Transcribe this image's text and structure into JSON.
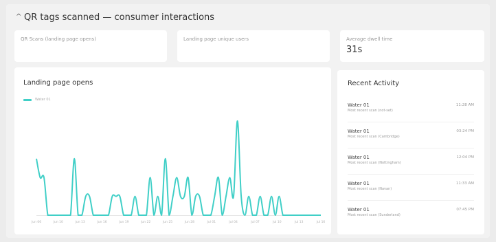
{
  "header": {
    "title": "QR tags scanned — consumer interactions"
  },
  "stats": [
    {
      "label": "QR Scans (landing page opens)",
      "value": ""
    },
    {
      "label": "Landing page unique users",
      "value": ""
    },
    {
      "label": "Average dwell time",
      "value": "31s"
    }
  ],
  "chart_card": {
    "title": "Landing page opens"
  },
  "chart_data": {
    "type": "line",
    "title": "Landing page opens",
    "xlabel": "",
    "ylabel": "",
    "legend_position": "top-left",
    "grid": false,
    "series": [
      {
        "name": "Water 01",
        "color": "#40cfc7",
        "values": [
          3,
          2,
          2,
          0,
          0,
          0,
          0,
          0,
          0,
          0,
          3,
          0,
          0,
          1,
          1,
          0,
          0,
          0,
          0,
          0,
          1,
          1,
          1,
          0,
          0,
          0,
          1,
          0,
          0,
          0,
          2,
          0,
          1,
          0,
          3,
          0,
          1,
          2,
          1,
          1,
          2,
          0,
          1,
          1,
          0,
          0,
          0,
          1,
          2,
          0,
          1,
          2,
          1,
          5,
          1,
          0,
          1,
          0,
          0,
          1,
          0,
          0,
          1,
          0,
          1,
          0,
          0,
          0,
          0,
          0,
          0,
          0,
          0,
          0,
          0,
          0
        ]
      }
    ],
    "x_tick_labels": [
      "Jun 06",
      "Jun 10",
      "Jun 13",
      "Jun 16",
      "Jun 19",
      "Jun 22",
      "Jun 25",
      "Jun 28",
      "Jul 01",
      "Jul 04",
      "Jul 07",
      "Jul 10",
      "Jul 13",
      "Jul 16"
    ],
    "ylim": [
      0,
      5
    ]
  },
  "recent": {
    "title": "Recent Activity",
    "items": [
      {
        "name": "Water 01",
        "sub": "Most recent scan (not-set)",
        "time": "11:28 AM"
      },
      {
        "name": "Water 01",
        "sub": "Most recent scan (Cambridge)",
        "time": "03:24 PM"
      },
      {
        "name": "Water 01",
        "sub": "Most recent scan (Nottingham)",
        "time": "12:04 PM"
      },
      {
        "name": "Water 01",
        "sub": "Most recent scan (Navan)",
        "time": "11:33 AM"
      },
      {
        "name": "Water 01",
        "sub": "Most recent scan (Sunderland)",
        "time": "07:45 PM"
      }
    ]
  }
}
